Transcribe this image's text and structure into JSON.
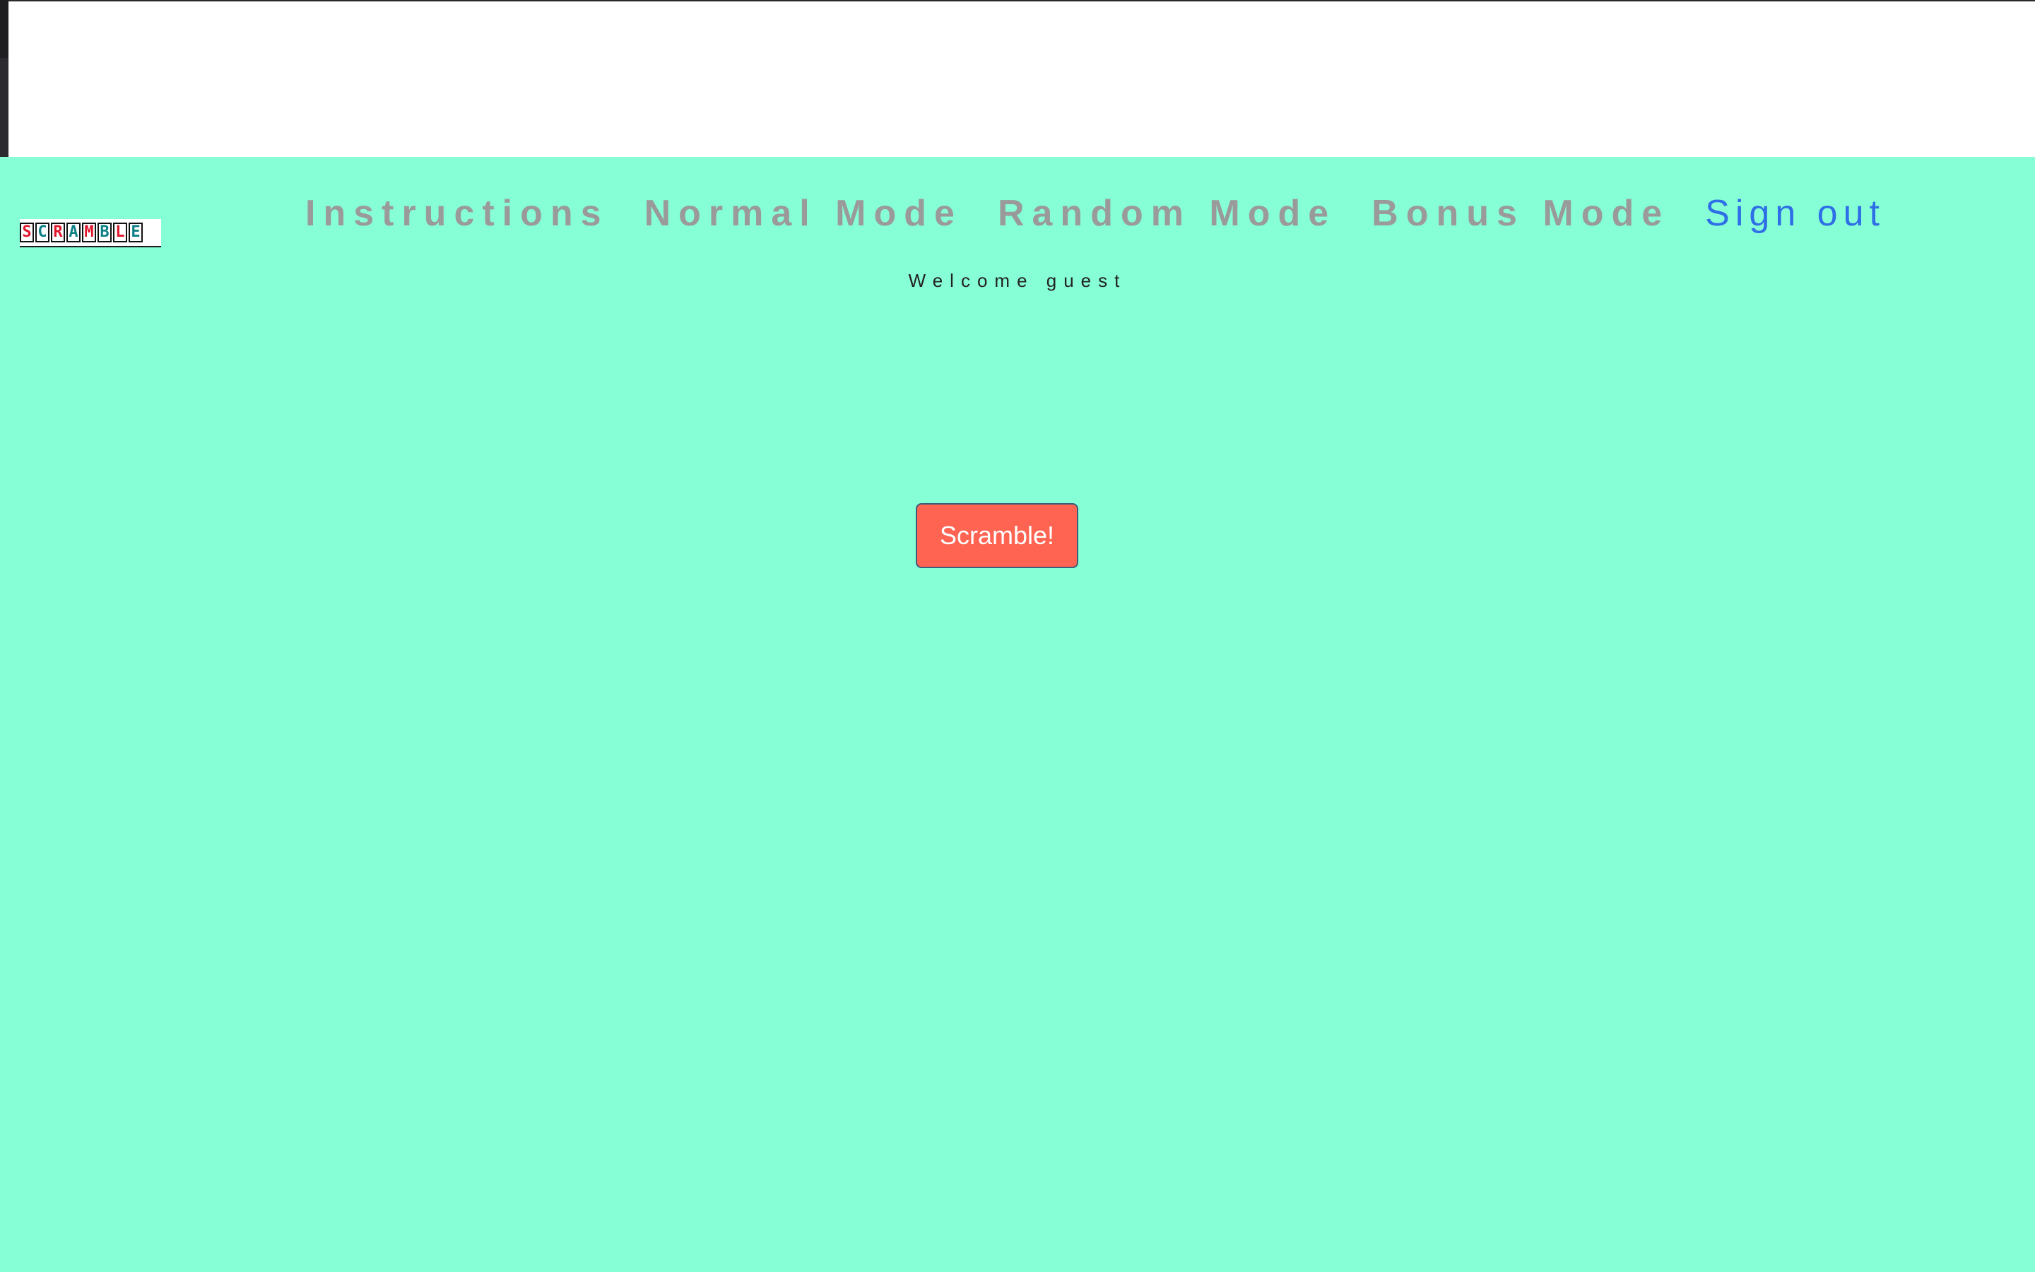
{
  "logo": {
    "tiles": [
      {
        "letter": "S",
        "tone": "red"
      },
      {
        "letter": "C",
        "tone": "teal"
      },
      {
        "letter": "R",
        "tone": "red"
      },
      {
        "letter": "A",
        "tone": "teal"
      },
      {
        "letter": "M",
        "tone": "red"
      },
      {
        "letter": "B",
        "tone": "teal"
      },
      {
        "letter": "L",
        "tone": "red"
      },
      {
        "letter": "E",
        "tone": "teal"
      }
    ]
  },
  "nav": {
    "instructions": "Instructions",
    "normal_mode": "Normal Mode",
    "random_mode": "Random Mode",
    "bonus_mode": "Bonus Mode",
    "sign_out": "Sign out"
  },
  "welcome_text": "Welcome guest",
  "scramble_button": "Scramble!",
  "colors": {
    "background": "#87FFD6",
    "nav_text": "#9A9A9A",
    "sign_out": "#2E6EE6",
    "button": "#FF6352"
  }
}
